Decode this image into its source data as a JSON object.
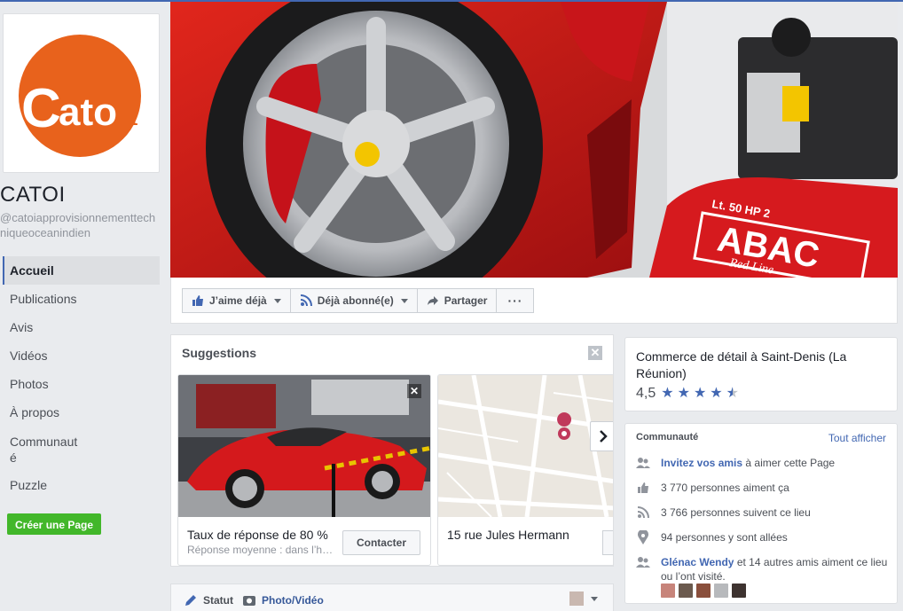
{
  "page": {
    "name": "CATOI",
    "handle": "@catoiapprovisionnementtechniqueoceanindien",
    "logo_text": "Catoi"
  },
  "nav": {
    "items": [
      {
        "label": "Accueil",
        "active": true
      },
      {
        "label": "Publications"
      },
      {
        "label": "Avis"
      },
      {
        "label": "Vidéos"
      },
      {
        "label": "Photos"
      },
      {
        "label": "À propos"
      },
      {
        "label": "Communauté"
      },
      {
        "label": "Puzzle"
      }
    ],
    "create_page": "Créer une Page"
  },
  "cover": {
    "compressor_label": "Lt. 50 HP 2",
    "brand": "ABAC",
    "brand_line": "Red Line"
  },
  "actions": {
    "like": "J’aime déjà",
    "follow": "Déjà abonné(e)",
    "share": "Partager",
    "more": "···"
  },
  "suggestions": {
    "title": "Suggestions",
    "close": "✕",
    "card1": {
      "text": "Taux de réponse de 80 %",
      "sub": "Réponse moyenne : dans l’heure",
      "button": "Contacter",
      "close": "✕"
    },
    "card2": {
      "text": "15 rue Jules Hermann"
    }
  },
  "composer": {
    "status": "Statut",
    "photo": "Photo/Vidéo"
  },
  "about": {
    "category": "Commerce de détail à Saint-Denis (La Réunion)",
    "rating": "4,5",
    "stars": 4.5
  },
  "community": {
    "title": "Communauté",
    "see_all": "Tout afficher",
    "invite_link": "Invitez vos amis",
    "invite_rest": " à aimer cette Page",
    "likes": "3 770 personnes aiment ça",
    "follows": "3 766 personnes suivent ce lieu",
    "visits": "94 personnes y sont allées",
    "friends_link": "Glénac Wendy",
    "friends_rest": " et 14 autres amis aiment ce lieu ou l’ont visité."
  },
  "colors": {
    "fb_blue": "#4267b2",
    "green": "#42b72a",
    "logo_orange": "#e8621c",
    "ferrari_red": "#d4191c"
  }
}
